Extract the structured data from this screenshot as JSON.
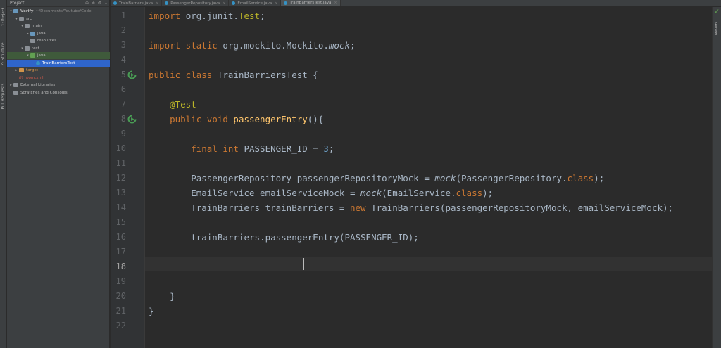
{
  "left_stripe": {
    "tabs": [
      "1: Project",
      "Z: Structure",
      "Pull Requests"
    ]
  },
  "project_panel": {
    "title": "Project",
    "tree": [
      {
        "label": "Verify",
        "suffix": "~/Documents/Youtube/Code",
        "arrow": "▾",
        "icon": "folder-blue",
        "depth": 0
      },
      {
        "label": "src",
        "arrow": "▾",
        "icon": "folder",
        "depth": 1
      },
      {
        "label": "main",
        "arrow": "▾",
        "icon": "folder",
        "depth": 2
      },
      {
        "label": "java",
        "arrow": "▸",
        "icon": "folder-blue",
        "depth": 3
      },
      {
        "label": "resources",
        "arrow": "",
        "icon": "folder",
        "depth": 3
      },
      {
        "label": "test",
        "arrow": "▾",
        "icon": "folder",
        "depth": 2
      },
      {
        "label": "java",
        "arrow": "▾",
        "icon": "folder-green",
        "depth": 3,
        "state": "sel-green"
      },
      {
        "label": "TrainBarriersTest",
        "arrow": "",
        "icon": "file-c",
        "depth": 4,
        "state": "sel-blue"
      },
      {
        "label": "target",
        "arrow": "▸",
        "icon": "folder-orange",
        "depth": 1
      },
      {
        "label": "pom.xml",
        "arrow": "",
        "icon": "m",
        "depth": 1
      },
      {
        "label": "External Libraries",
        "arrow": "▸",
        "icon": "folder",
        "depth": 0
      },
      {
        "label": "Scratches and Consoles",
        "arrow": "",
        "icon": "folder",
        "depth": 0
      }
    ]
  },
  "tabs": [
    {
      "label": "TrainBarriers.java",
      "active": false
    },
    {
      "label": "PassengerRepository.java",
      "active": false
    },
    {
      "label": "EmailService.java",
      "active": false
    },
    {
      "label": "TrainBarriersTest.java",
      "active": true
    }
  ],
  "right_stripe": {
    "tabs": [
      "Maven"
    ]
  },
  "editor": {
    "current_line": 18,
    "lines": [
      {
        "n": "1",
        "tokens": [
          [
            "kw",
            "import "
          ],
          [
            "",
            "org.junit."
          ],
          [
            "ann",
            "Test"
          ],
          [
            "",
            ";"
          ]
        ]
      },
      {
        "n": "2",
        "tokens": []
      },
      {
        "n": "3",
        "tokens": [
          [
            "kw",
            "import static "
          ],
          [
            "",
            "org.mockito.Mockito."
          ],
          [
            "it",
            "mock"
          ],
          [
            "",
            ";"
          ]
        ]
      },
      {
        "n": "4",
        "tokens": []
      },
      {
        "n": "5",
        "run": true,
        "tokens": [
          [
            "kw",
            "public class "
          ],
          [
            "",
            "TrainBarriersTest {"
          ]
        ]
      },
      {
        "n": "6",
        "tokens": []
      },
      {
        "n": "7",
        "tokens": [
          [
            "",
            "    "
          ],
          [
            "ann",
            "@Test"
          ]
        ]
      },
      {
        "n": "8",
        "run": true,
        "tokens": [
          [
            "",
            "    "
          ],
          [
            "kw",
            "public void "
          ],
          [
            "fn",
            "passengerEntry"
          ],
          [
            "",
            "(){"
          ]
        ]
      },
      {
        "n": "9",
        "tokens": []
      },
      {
        "n": "10",
        "tokens": [
          [
            "",
            "        "
          ],
          [
            "kw",
            "final int "
          ],
          [
            "",
            "PASSENGER_ID = "
          ],
          [
            "num",
            "3"
          ],
          [
            "",
            ";"
          ]
        ]
      },
      {
        "n": "11",
        "tokens": []
      },
      {
        "n": "12",
        "tokens": [
          [
            "",
            "        PassengerRepository passengerRepositoryMock = "
          ],
          [
            "it",
            "mock"
          ],
          [
            "",
            "(PassengerRepository."
          ],
          [
            "kw",
            "class"
          ],
          [
            "",
            ");"
          ]
        ]
      },
      {
        "n": "13",
        "tokens": [
          [
            "",
            "        EmailService emailServiceMock = "
          ],
          [
            "it",
            "mock"
          ],
          [
            "",
            "(EmailService."
          ],
          [
            "kw",
            "class"
          ],
          [
            "",
            ");"
          ]
        ]
      },
      {
        "n": "14",
        "tokens": [
          [
            "",
            "        TrainBarriers trainBarriers = "
          ],
          [
            "kw",
            "new "
          ],
          [
            "",
            "TrainBarriers(passengerRepositoryMock, emailServiceMock);"
          ]
        ]
      },
      {
        "n": "15",
        "tokens": []
      },
      {
        "n": "16",
        "tokens": [
          [
            "",
            "        trainBarriers.passengerEntry(PASSENGER_ID);"
          ]
        ]
      },
      {
        "n": "17",
        "tokens": []
      },
      {
        "n": "18",
        "tokens": []
      },
      {
        "n": "19",
        "tokens": []
      },
      {
        "n": "20",
        "tokens": [
          [
            "",
            "    }"
          ]
        ]
      },
      {
        "n": "21",
        "tokens": [
          [
            "",
            "}"
          ]
        ]
      },
      {
        "n": "22",
        "tokens": []
      }
    ]
  },
  "colors": {
    "background": "#2b2b2b",
    "keyword": "#cc7832",
    "annotation": "#bbb529",
    "number": "#6897bb",
    "method": "#ffc66d",
    "text": "#a9b7c6"
  }
}
